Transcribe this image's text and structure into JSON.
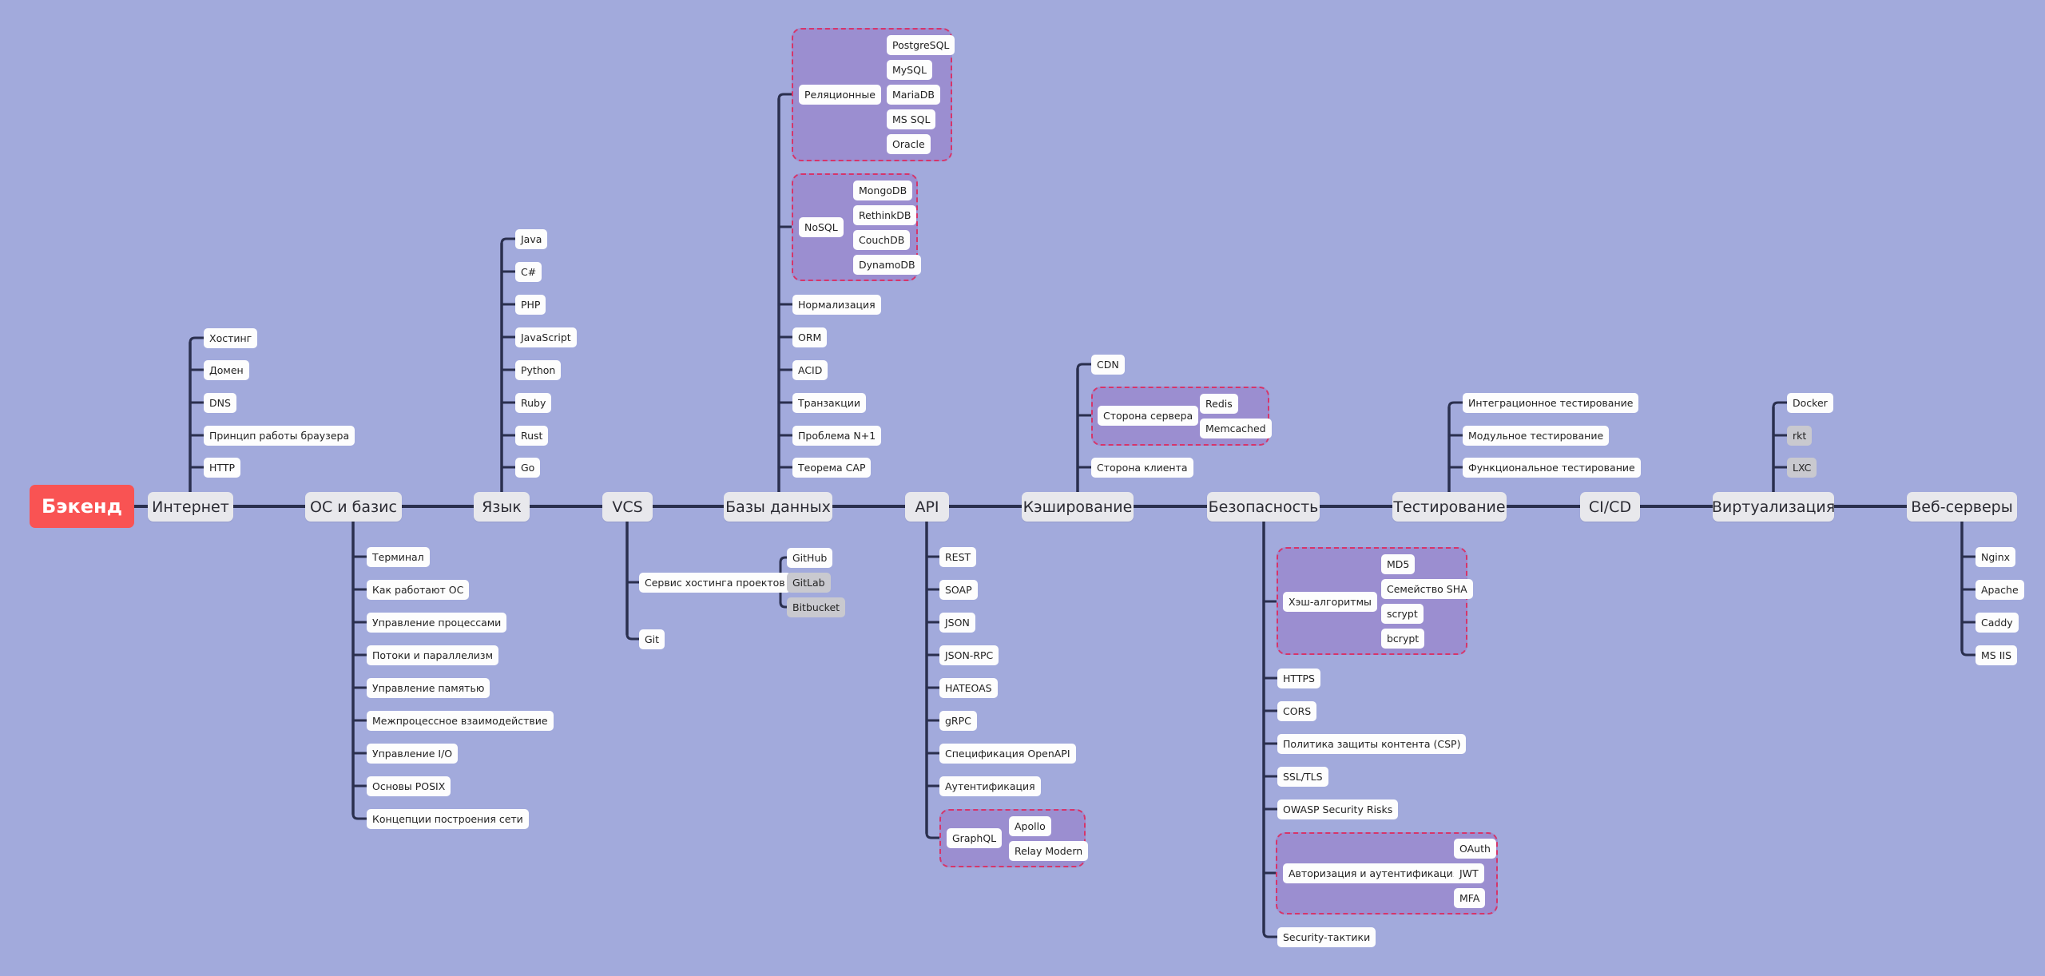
{
  "title": "Бэкенд",
  "colors": {
    "background": "#a2aadc",
    "root": "#f95353",
    "main_node": "#e8e8ec",
    "leaf": "#fdfdfd",
    "optional_leaf": "#c9c9cf",
    "group_fill": "#9b8ed0",
    "group_border": "#d6356a",
    "connector": "#2a2f4e"
  },
  "topics": [
    {
      "label": "Интернет",
      "items": [
        {
          "label": "Хостинг"
        },
        {
          "label": "Домен"
        },
        {
          "label": "DNS"
        },
        {
          "label": "Принцип работы браузера"
        },
        {
          "label": "HTTP"
        }
      ]
    },
    {
      "label": "ОС и базис",
      "items": [
        {
          "label": "Терминал"
        },
        {
          "label": "Как работают ОС"
        },
        {
          "label": "Управление процессами"
        },
        {
          "label": "Потоки и параллелизм"
        },
        {
          "label": "Управление памятью"
        },
        {
          "label": "Межпроцессное взаимодействие"
        },
        {
          "label": "Управление I/O"
        },
        {
          "label": "Основы POSIX"
        },
        {
          "label": "Концепции построения сети"
        }
      ]
    },
    {
      "label": "Язык",
      "items": [
        {
          "label": "Java"
        },
        {
          "label": "C#"
        },
        {
          "label": "PHP"
        },
        {
          "label": "JavaScript"
        },
        {
          "label": "Python"
        },
        {
          "label": "Ruby"
        },
        {
          "label": "Rust"
        },
        {
          "label": "Go"
        }
      ]
    },
    {
      "label": "VCS",
      "items": [
        {
          "label": "Сервис хостинга проектов",
          "children": [
            {
              "label": "GitHub"
            },
            {
              "label": "GitLab",
              "optional": true
            },
            {
              "label": "Bitbucket",
              "optional": true
            }
          ]
        },
        {
          "label": "Git"
        }
      ]
    },
    {
      "label": "Базы данных",
      "items": [
        {
          "label": "Реляционные",
          "children": [
            {
              "label": "PostgreSQL"
            },
            {
              "label": "MySQL"
            },
            {
              "label": "MariaDB"
            },
            {
              "label": "MS SQL"
            },
            {
              "label": "Oracle"
            }
          ]
        },
        {
          "label": "NoSQL",
          "children": [
            {
              "label": "MongoDB"
            },
            {
              "label": "RethinkDB"
            },
            {
              "label": "CouchDB"
            },
            {
              "label": "DynamoDB"
            }
          ]
        },
        {
          "label": "Нормализация"
        },
        {
          "label": "ORM"
        },
        {
          "label": "ACID"
        },
        {
          "label": "Транзакции"
        },
        {
          "label": "Проблема N+1"
        },
        {
          "label": "Теорема CAP"
        }
      ]
    },
    {
      "label": "API",
      "items": [
        {
          "label": "REST"
        },
        {
          "label": "SOAP"
        },
        {
          "label": "JSON"
        },
        {
          "label": "JSON-RPC"
        },
        {
          "label": "HATEOAS"
        },
        {
          "label": "gRPC"
        },
        {
          "label": "Спецификация OpenAPI"
        },
        {
          "label": "Аутентификация"
        },
        {
          "label": "GraphQL",
          "children": [
            {
              "label": "Apollo"
            },
            {
              "label": "Relay Modern"
            }
          ]
        }
      ]
    },
    {
      "label": "Кэширование",
      "items": [
        {
          "label": "CDN"
        },
        {
          "label": "Сторона сервера",
          "children": [
            {
              "label": "Redis"
            },
            {
              "label": "Memcached"
            }
          ]
        },
        {
          "label": "Сторона клиента"
        }
      ]
    },
    {
      "label": "Безопасность",
      "items": [
        {
          "label": "Хэш-алгоритмы",
          "children": [
            {
              "label": "MD5"
            },
            {
              "label": "Семейство SHA"
            },
            {
              "label": "scrypt"
            },
            {
              "label": "bcrypt"
            }
          ]
        },
        {
          "label": "HTTPS"
        },
        {
          "label": "CORS"
        },
        {
          "label": "Политика защиты контента (CSP)"
        },
        {
          "label": "SSL/TLS"
        },
        {
          "label": "OWASP Security Risks"
        },
        {
          "label": "Авторизация и аутентификация",
          "children": [
            {
              "label": "OAuth"
            },
            {
              "label": "JWT"
            },
            {
              "label": "MFA"
            }
          ]
        },
        {
          "label": "Security-тактики"
        }
      ]
    },
    {
      "label": "Тестирование",
      "items": [
        {
          "label": "Интеграционное тестирование"
        },
        {
          "label": "Модульное тестирование"
        },
        {
          "label": "Функциональное тестирование"
        }
      ]
    },
    {
      "label": "CI/CD",
      "items": []
    },
    {
      "label": "Виртуализация",
      "items": [
        {
          "label": "Docker"
        },
        {
          "label": "rkt",
          "optional": true
        },
        {
          "label": "LXC",
          "optional": true
        }
      ]
    },
    {
      "label": "Веб-серверы",
      "items": [
        {
          "label": "Nginx"
        },
        {
          "label": "Apache"
        },
        {
          "label": "Caddy"
        },
        {
          "label": "MS IIS"
        }
      ]
    }
  ]
}
